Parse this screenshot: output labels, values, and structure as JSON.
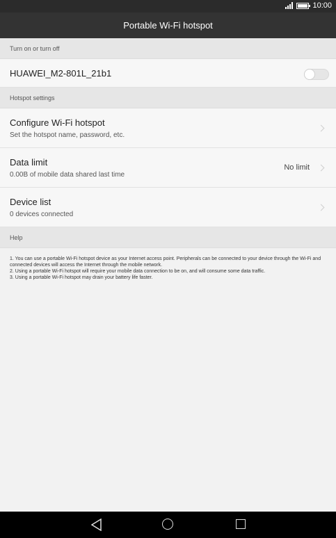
{
  "status_bar": {
    "time": "10:00",
    "signal_icon": "signal-icon",
    "battery_icon": "battery-icon"
  },
  "header": {
    "title": "Portable Wi-Fi hotspot"
  },
  "section_power": {
    "label": "Turn on or turn off"
  },
  "hotspot_toggle": {
    "name": "HUAWEI_M2-801L_21b1",
    "enabled": false
  },
  "section_settings": {
    "label": "Hotspot settings"
  },
  "configure": {
    "title": "Configure Wi-Fi hotspot",
    "subtitle": "Set the hotspot name, password, etc."
  },
  "data_limit": {
    "title": "Data limit",
    "subtitle": "0.00B of mobile data shared last time",
    "value": "No limit"
  },
  "device_list": {
    "title": "Device list",
    "subtitle": "0 devices connected"
  },
  "section_help": {
    "label": "Help"
  },
  "help": {
    "line1": "1. You can use a portable Wi-Fi hotspot device as your Internet access point. Peripherals can be connected to your device through the Wi-Fi and connected devices will access the Internet through the mobile network.",
    "line2": "2. Using a portable Wi-Fi hotspot will require your mobile data connection to be on, and will consume some data traffic.",
    "line3": "3. Using a portable Wi-Fi hotspot may drain your battery life faster."
  },
  "nav": {
    "back_icon": "back-icon",
    "home_icon": "home-icon",
    "recent_icon": "recent-apps-icon"
  }
}
